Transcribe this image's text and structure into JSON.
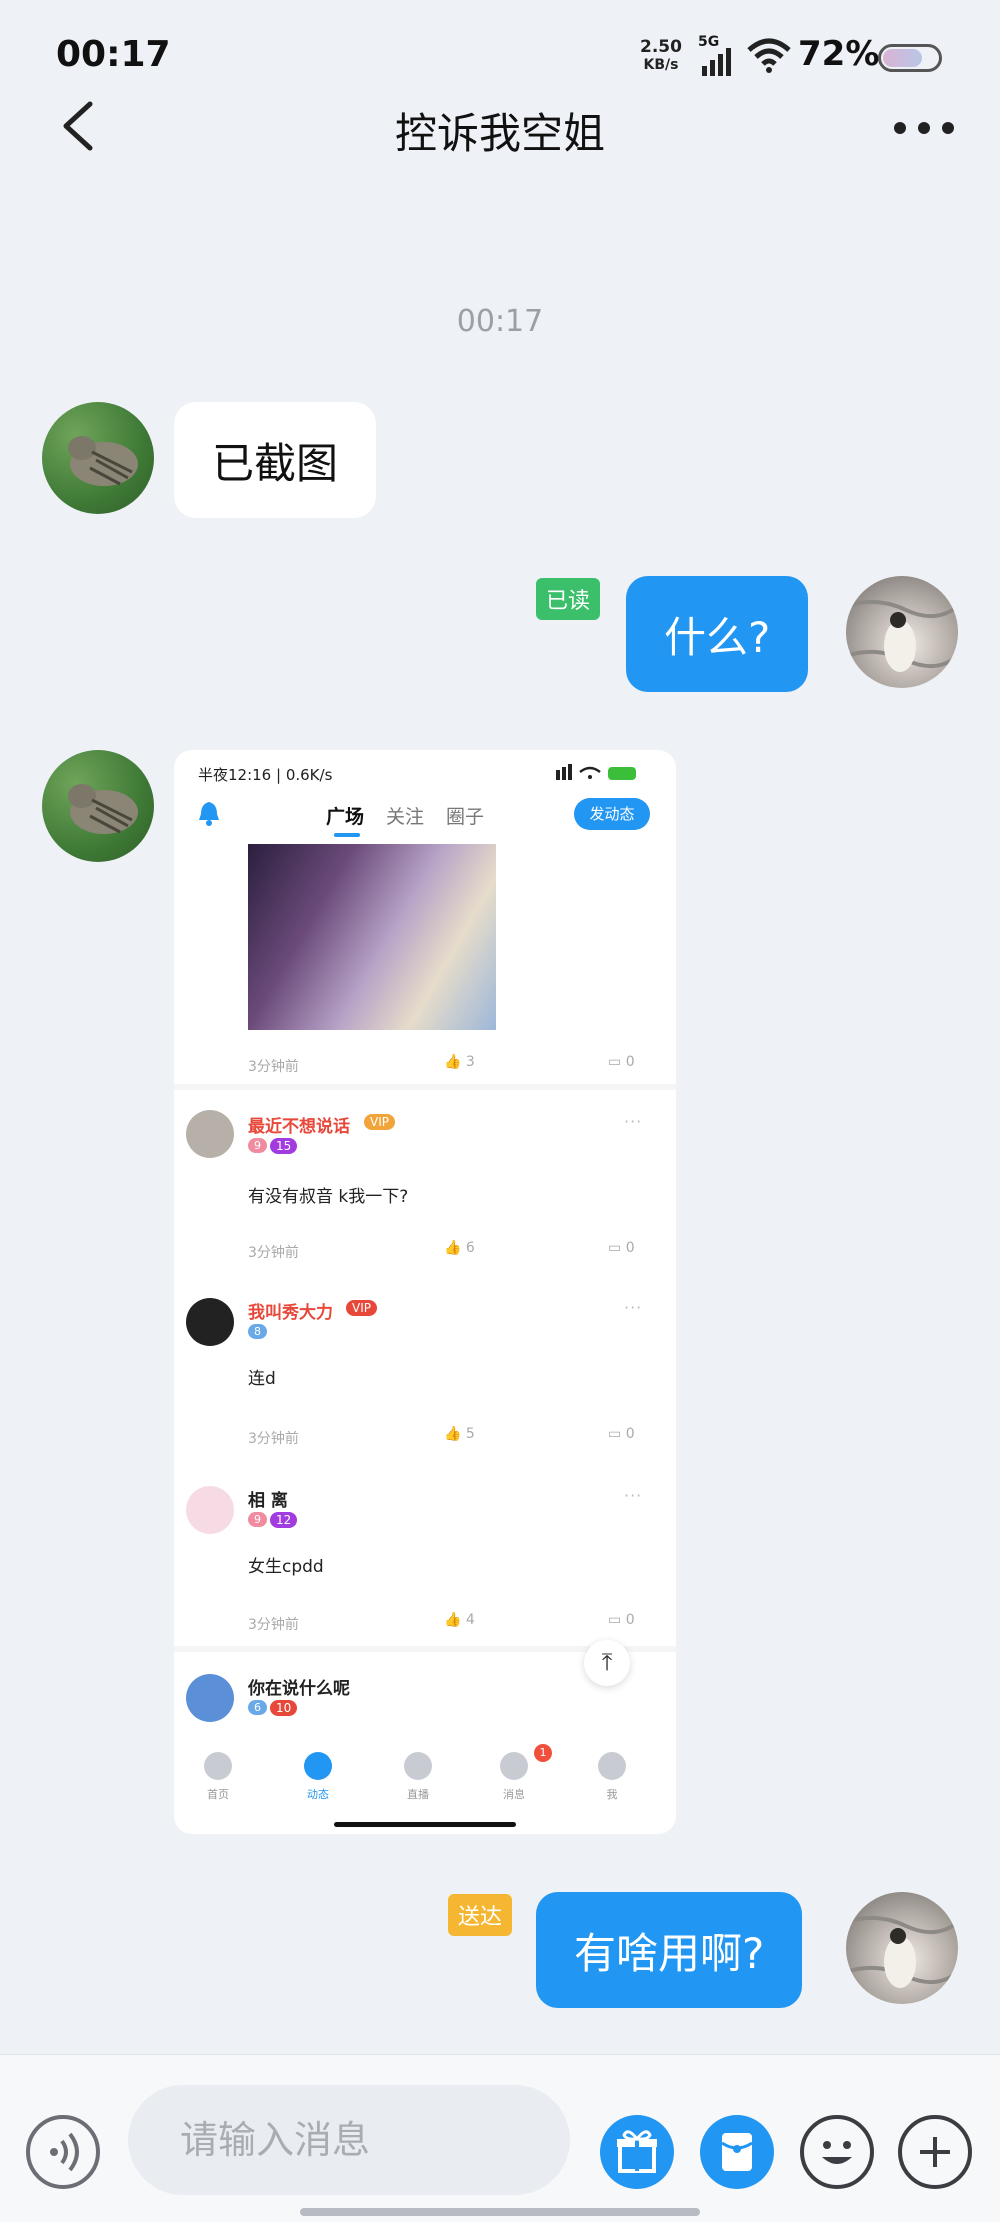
{
  "status_bar": {
    "time": "00:17",
    "net_speed_value": "2.50",
    "net_speed_unit": "KB/s",
    "network_type": "5G",
    "battery_percent": "72%",
    "battery_level": 0.72
  },
  "header": {
    "title": "控诉我空姐",
    "back_icon": "chevron-left-icon",
    "more_icon": "more-dots-icon"
  },
  "chat": {
    "timestamp": "00:17",
    "messages": [
      {
        "direction": "in",
        "text": "已截图"
      },
      {
        "direction": "out",
        "text": "什么?",
        "status": "已读"
      },
      {
        "direction": "in",
        "type": "image"
      },
      {
        "direction": "out",
        "text": "有啥用啊?",
        "status": "送达"
      }
    ]
  },
  "screenshot": {
    "status_left": "半夜12:16 | 0.6K/s",
    "tabs": [
      "广场",
      "关注",
      "圈子"
    ],
    "post_button": "发动态",
    "first_post": {
      "time": "3分钟前",
      "likes": "3",
      "replies": "0"
    },
    "posts": [
      {
        "name": "最近不想说话",
        "vip": "VIP",
        "level": "9",
        "badge": "15",
        "text": "有没有叔音 k我一下?",
        "time": "3分钟前",
        "likes": "6",
        "replies": "0",
        "name_color": "#e8483a"
      },
      {
        "name": "我叫秀大力",
        "vip": "VIP",
        "level": "8",
        "badge": "",
        "text": "连d",
        "time": "3分钟前",
        "likes": "5",
        "replies": "0",
        "name_color": "#e8483a"
      },
      {
        "name": "相 离",
        "vip": "",
        "level": "9",
        "badge": "12",
        "text": "女生cpdd",
        "time": "3分钟前",
        "likes": "4",
        "replies": "0",
        "name_color": "#222222"
      },
      {
        "name": "你在说什么呢",
        "vip": "",
        "level": "6",
        "badge": "10",
        "text": "",
        "time": "",
        "likes": "",
        "replies": "",
        "name_color": "#222222"
      }
    ],
    "nav": [
      {
        "label": "首页"
      },
      {
        "label": "动态"
      },
      {
        "label": "直播"
      },
      {
        "label": "消息",
        "badge": "1"
      },
      {
        "label": "我"
      }
    ]
  },
  "input_bar": {
    "placeholder": "请输入消息"
  },
  "colors": {
    "accent": "#2196f3",
    "read_badge": "#3bbf6a",
    "sent_badge": "#f5b731"
  }
}
